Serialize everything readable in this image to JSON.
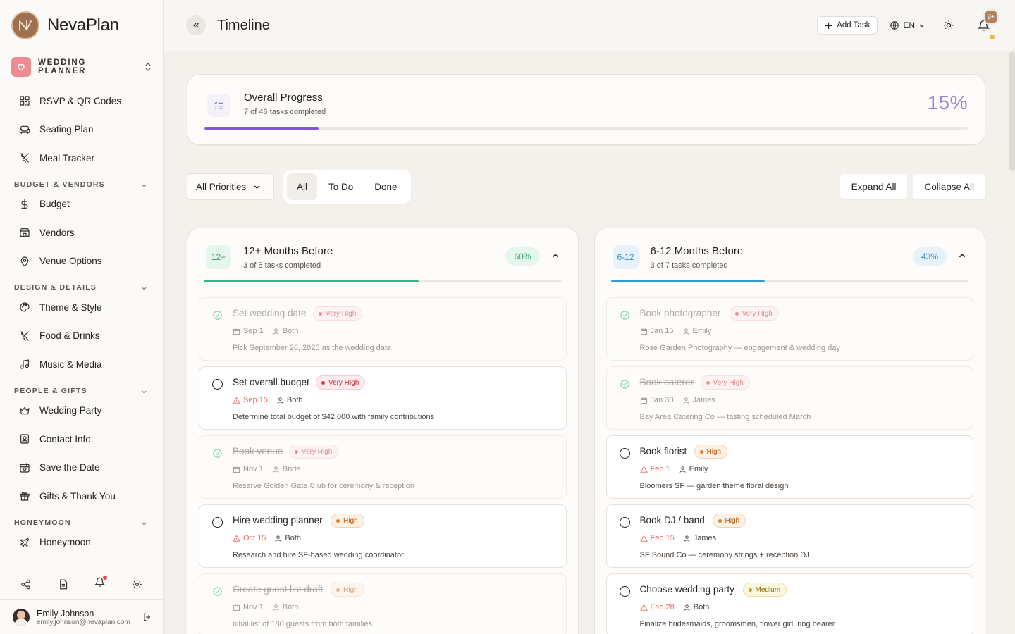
{
  "app": {
    "name": "NevaPlan",
    "workspace": "WEDDING PLANNER"
  },
  "sidebar": {
    "top_items": [
      {
        "label": "RSVP & QR Codes",
        "icon": "qr-code-icon"
      },
      {
        "label": "Seating Plan",
        "icon": "sofa-icon"
      },
      {
        "label": "Meal Tracker",
        "icon": "utensils-icon"
      }
    ],
    "sections": [
      {
        "title": "BUDGET & VENDORS",
        "items": [
          {
            "label": "Budget",
            "icon": "dollar-icon"
          },
          {
            "label": "Vendors",
            "icon": "store-icon"
          },
          {
            "label": "Venue Options",
            "icon": "map-pin-icon"
          }
        ]
      },
      {
        "title": "DESIGN & DETAILS",
        "items": [
          {
            "label": "Theme & Style",
            "icon": "palette-icon"
          },
          {
            "label": "Food & Drinks",
            "icon": "utensils-icon"
          },
          {
            "label": "Music & Media",
            "icon": "music-icon"
          }
        ]
      },
      {
        "title": "PEOPLE & GIFTS",
        "items": [
          {
            "label": "Wedding Party",
            "icon": "crown-icon"
          },
          {
            "label": "Contact Info",
            "icon": "contact-icon"
          },
          {
            "label": "Save the Date",
            "icon": "calendar-heart-icon"
          },
          {
            "label": "Gifts & Thank You",
            "icon": "gift-icon"
          }
        ]
      },
      {
        "title": "HONEYMOON",
        "items": [
          {
            "label": "Honeymoon",
            "icon": "plane-icon"
          }
        ]
      }
    ],
    "user": {
      "name": "Emily Johnson",
      "email": "emily.johnson@nevaplan.com"
    }
  },
  "header": {
    "title": "Timeline",
    "add_task": "Add Task",
    "language": "EN",
    "notification_badge": "9+"
  },
  "overall": {
    "title": "Overall Progress",
    "subtitle": "7 of 46 tasks completed",
    "percent_label": "15%",
    "progress": 0.15
  },
  "filters": {
    "priority": "All Priorities",
    "segments": [
      "All",
      "To Do",
      "Done"
    ],
    "active_segment": "All",
    "expand_all": "Expand All",
    "collapse_all": "Collapse All"
  },
  "columns": [
    {
      "badge": "12+",
      "title": "12+ Months Before",
      "subtitle": "3 of 5 tasks completed",
      "percent_label": "60%",
      "progress": 0.6,
      "accent": "#2cb884",
      "tasks": [
        {
          "title": "Set wedding date",
          "priority": "Very High",
          "date": "Sep 1",
          "owner": "Both",
          "desc": "Pick September 26, 2026 as the wedding date",
          "done": true
        },
        {
          "title": "Set overall budget",
          "priority": "Very High",
          "date": "Sep 15",
          "owner": "Both",
          "desc": "Determine total budget of $42,000 with family contributions",
          "done": false
        },
        {
          "title": "Book venue",
          "priority": "Very High",
          "date": "Nov 1",
          "owner": "Bride",
          "desc": "Reserve Golden Gate Club for ceremony & reception",
          "done": true
        },
        {
          "title": "Hire wedding planner",
          "priority": "High",
          "date": "Oct 15",
          "owner": "Both",
          "desc": "Research and hire SF-based wedding coordinator",
          "done": false
        },
        {
          "title": "Create guest list draft",
          "priority": "High",
          "date": "Nov 1",
          "owner": "Both",
          "desc": "nitial list of 180 guests from both families",
          "done": true
        }
      ]
    },
    {
      "badge": "6-12",
      "title": "6-12 Months Before",
      "subtitle": "3 of 7 tasks completed",
      "percent_label": "43%",
      "progress": 0.43,
      "accent": "#2e9bd6",
      "tasks": [
        {
          "title": "Book photographer",
          "priority": "Very High",
          "date": "Jan 15",
          "owner": "Emily",
          "desc": "Rose Garden Photography — engagement & wedding day",
          "done": true
        },
        {
          "title": "Book caterer",
          "priority": "Very High",
          "date": "Jan 30",
          "owner": "James",
          "desc": "Bay Area Catering Co — tasting scheduled March",
          "done": true
        },
        {
          "title": "Book florist",
          "priority": "High",
          "date": "Feb 1",
          "owner": "Emily",
          "desc": "Bloomers SF — garden theme floral design",
          "done": false
        },
        {
          "title": "Book DJ / band",
          "priority": "High",
          "date": "Feb 15",
          "owner": "James",
          "desc": "SF Sound Co — ceremony strings + reception DJ",
          "done": false
        },
        {
          "title": "Choose wedding party",
          "priority": "Medium",
          "date": "Feb 28",
          "owner": "Both",
          "desc": "Finalize bridesmaids, groomsmen, flower girl, ring bearer",
          "done": false
        }
      ]
    }
  ]
}
